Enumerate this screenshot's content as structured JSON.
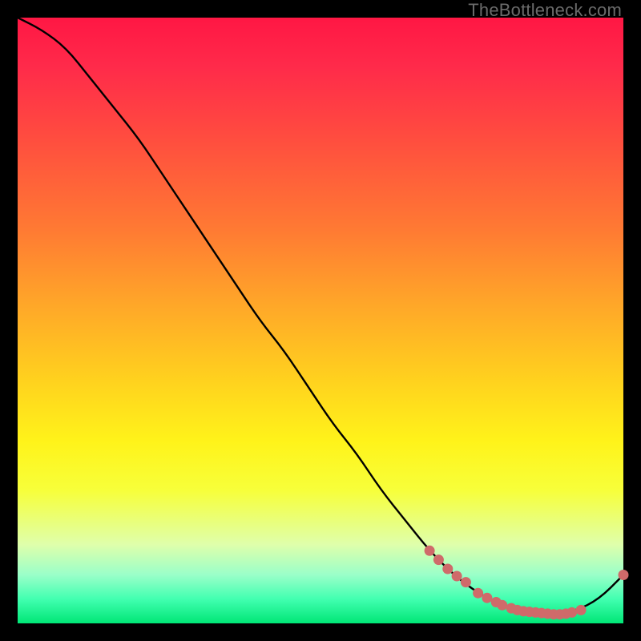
{
  "watermark": "TheBottleneck.com",
  "colors": {
    "curve": "#000000",
    "dot_fill": "#cf6a6a",
    "dot_stroke": "#cf6a6a"
  },
  "chart_data": {
    "type": "line",
    "title": "",
    "xlabel": "",
    "ylabel": "",
    "xlim": [
      0,
      100
    ],
    "ylim": [
      0,
      100
    ],
    "grid": false,
    "legend": false,
    "series": [
      {
        "name": "bottleneck-curve",
        "x": [
          0,
          4,
          8,
          12,
          16,
          20,
          24,
          28,
          32,
          36,
          40,
          44,
          48,
          52,
          56,
          60,
          64,
          68,
          72,
          76,
          80,
          84,
          88,
          92,
          96,
          100
        ],
        "y": [
          100,
          98,
          95,
          90,
          85,
          80,
          74,
          68,
          62,
          56,
          50,
          45,
          39,
          33,
          28,
          22,
          17,
          12,
          8,
          5,
          3,
          2,
          1.5,
          2,
          4,
          8
        ]
      }
    ],
    "highlight_points": {
      "name": "highlighted-dots",
      "x": [
        68,
        69.5,
        71,
        72.5,
        74,
        76,
        77.5,
        79,
        80,
        81.5,
        82.5,
        83.5,
        84.5,
        85.5,
        86.5,
        87.5,
        88.5,
        89.5,
        90.5,
        91.5,
        93,
        100
      ],
      "y": [
        12,
        10.5,
        9,
        7.8,
        6.8,
        5,
        4.2,
        3.5,
        3,
        2.5,
        2.2,
        2,
        1.9,
        1.8,
        1.7,
        1.6,
        1.5,
        1.5,
        1.6,
        1.8,
        2.2,
        8
      ]
    }
  }
}
